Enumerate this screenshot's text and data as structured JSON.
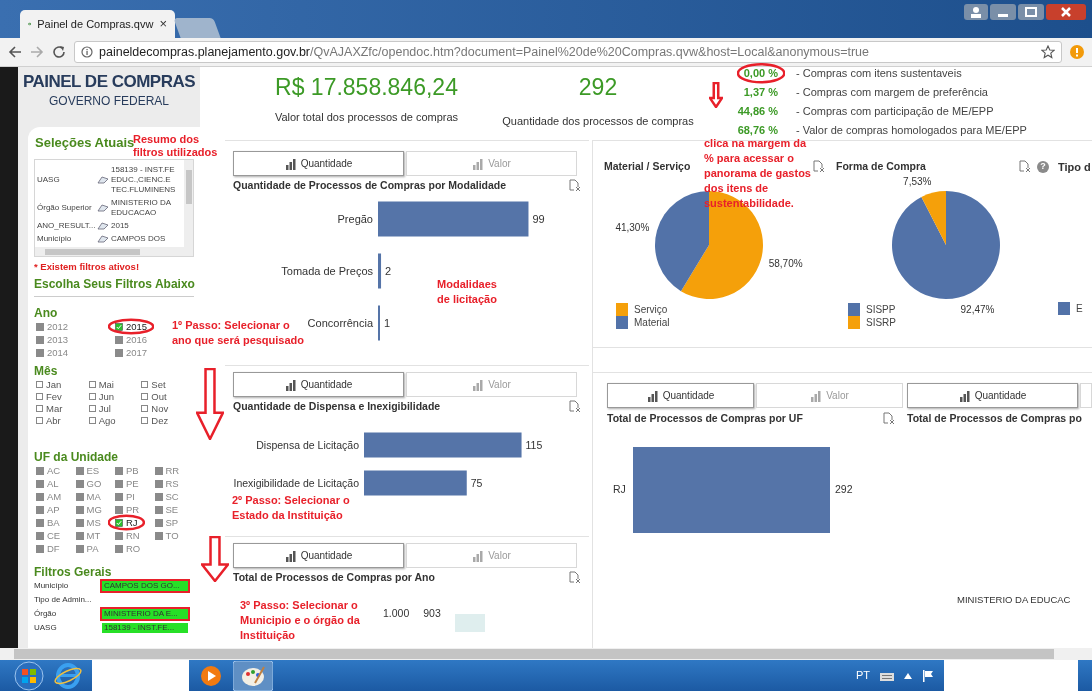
{
  "browser": {
    "tab_title": "Painel de Compras.qvw",
    "tab_close": "×",
    "url_host": "paineldecompras.planejamento.gov.br",
    "url_path": "/QvAJAXZfc/opendoc.htm?document=Painel%20de%20Compras.qvw&host=Local&anonymous=true"
  },
  "logo": {
    "title": "PAINEL DE COMPRAS",
    "subtitle": "GOVERNO FEDERAL"
  },
  "current_selections": {
    "title": "Seleções Atuais",
    "rows": [
      {
        "field": "UASG",
        "value": "158139 - INST.FE EDUC.,CIENC.E TEC.FLUMINENS"
      },
      {
        "field": "Órgão Superior",
        "value": "MINISTERIO DA EDUCACAO"
      },
      {
        "field": "ANO_RESULT...",
        "value": "2015"
      },
      {
        "field": "Município",
        "value": "CAMPOS DOS"
      }
    ],
    "warning": "* Existem filtros ativos!"
  },
  "filters_heading": "Escolha Seus Filtros Abaixo",
  "ano": {
    "title": "Ano",
    "items": [
      {
        "label": "2012",
        "selected": false
      },
      {
        "label": "2013",
        "selected": false
      },
      {
        "label": "2014",
        "selected": false
      },
      {
        "label": "2015",
        "selected": true
      },
      {
        "label": "2016",
        "selected": false
      },
      {
        "label": "2017",
        "selected": false
      }
    ]
  },
  "mes": {
    "title": "Mês",
    "items": [
      {
        "label": "Jan",
        "checked": false
      },
      {
        "label": "Fev",
        "checked": false
      },
      {
        "label": "Mar",
        "checked": false
      },
      {
        "label": "Abr",
        "checked": false
      },
      {
        "label": "Mai",
        "checked": false
      },
      {
        "label": "Jun",
        "checked": false
      },
      {
        "label": "Jul",
        "checked": false
      },
      {
        "label": "Ago",
        "checked": false
      },
      {
        "label": "Set",
        "checked": false
      },
      {
        "label": "Out",
        "checked": false
      },
      {
        "label": "Nov",
        "checked": false
      },
      {
        "label": "Dez",
        "checked": false
      }
    ]
  },
  "uf": {
    "title": "UF da Unidade",
    "items": [
      {
        "label": "AC",
        "selected": false
      },
      {
        "label": "AL",
        "selected": false
      },
      {
        "label": "AM",
        "selected": false
      },
      {
        "label": "AP",
        "selected": false
      },
      {
        "label": "BA",
        "selected": false
      },
      {
        "label": "CE",
        "selected": false
      },
      {
        "label": "DF",
        "selected": false
      },
      {
        "label": "ES",
        "selected": false
      },
      {
        "label": "GO",
        "selected": false
      },
      {
        "label": "MA",
        "selected": false
      },
      {
        "label": "MG",
        "selected": false
      },
      {
        "label": "MS",
        "selected": false
      },
      {
        "label": "MT",
        "selected": false
      },
      {
        "label": "PA",
        "selected": false
      },
      {
        "label": "PB",
        "selected": false
      },
      {
        "label": "PE",
        "selected": false
      },
      {
        "label": "PI",
        "selected": false
      },
      {
        "label": "PR",
        "selected": false
      },
      {
        "label": "RJ",
        "selected": true
      },
      {
        "label": "RN",
        "selected": false
      },
      {
        "label": "RO",
        "selected": false
      },
      {
        "label": "RR",
        "selected": false
      },
      {
        "label": "RS",
        "selected": false
      },
      {
        "label": "SC",
        "selected": false
      },
      {
        "label": "SE",
        "selected": false
      },
      {
        "label": "SP",
        "selected": false
      },
      {
        "label": "TO",
        "selected": false
      }
    ]
  },
  "general_filters": {
    "title": "Filtros Gerais",
    "rows": [
      {
        "label": "Município",
        "value": "CAMPOS DOS GO..."
      },
      {
        "label": "Tipo de Admin..."
      },
      {
        "label": "Órgão",
        "value": "MINISTERIO DA E..."
      },
      {
        "label": "UASG",
        "value": "158139 - INST.FE..."
      }
    ]
  },
  "kpis": [
    {
      "value": "R$ 17.858.846,24",
      "caption": "Valor total dos processos de compras"
    },
    {
      "value": "292",
      "caption": "Quantidade dos processos de compras"
    }
  ],
  "indicators": [
    {
      "value": "0,00 %",
      "label": "- Compras com itens sustentaveis"
    },
    {
      "value": "1,37 %",
      "label": "- Compras com margem de preferência"
    },
    {
      "value": "44,86 %",
      "label": "- Compras com participação de ME/EPP"
    },
    {
      "value": "68,76 %",
      "label": "- Valor de compras homologados para ME/EPP"
    }
  ],
  "modalidade_panel": {
    "toggles": [
      {
        "label": "Quantidade",
        "selected": true
      },
      {
        "label": "Valor",
        "selected": false
      }
    ],
    "chart_data": {
      "type": "bar",
      "orientation": "horizontal",
      "title": "Quantidade de Processos de Compras por Modalidade",
      "categories": [
        "Pregão",
        "Tomada de Preços",
        "Concorrência"
      ],
      "values": [
        99,
        2,
        1
      ],
      "data_labels": true
    }
  },
  "dispensa_panel": {
    "toggles": [
      {
        "label": "Quantidade",
        "selected": true
      },
      {
        "label": "Valor",
        "selected": false
      }
    ],
    "chart_data": {
      "type": "bar",
      "orientation": "horizontal",
      "title": "Quantidade de Dispensa e Inexigibilidade",
      "categories": [
        "Dispensa de Licitação",
        "Inexigibilidade de Licitação"
      ],
      "values": [
        115,
        75
      ],
      "data_labels": true
    }
  },
  "ano_panel": {
    "toggles": [
      {
        "label": "Quantidade",
        "selected": true
      },
      {
        "label": "Valor",
        "selected": false
      }
    ],
    "title": "Total de Processos de Compras por Ano",
    "axis_labels": [
      "1.000",
      "903"
    ]
  },
  "material_panel": {
    "legend": [
      {
        "color": "#f5a00a"
      },
      {
        "color": "#5272a8"
      }
    ],
    "chart_data": {
      "type": "pie",
      "title": "Material / Serviço",
      "categories": [
        "Serviço",
        "Material"
      ],
      "values": [
        58.7,
        41.3
      ],
      "value_labels": [
        "58,70%",
        "41,30%"
      ]
    }
  },
  "forma_panel": {
    "help": "?",
    "legend": [
      {
        "color": "#5272a8"
      },
      {
        "color": "#f5a00a"
      }
    ],
    "chart_data": {
      "type": "pie",
      "title": "Forma de Compra",
      "categories": [
        "SISPP",
        "SISRP"
      ],
      "values": [
        92.47,
        7.53
      ],
      "value_labels": [
        "92,47%",
        "7,53%"
      ]
    }
  },
  "tipo_panel": {
    "title": "Tipo d",
    "legend": [
      {
        "label": "E",
        "color": "#5272a8"
      }
    ]
  },
  "uf_panel": {
    "toggles": [
      {
        "label": "Quantidade",
        "selected": true
      },
      {
        "label": "Valor",
        "selected": false
      }
    ],
    "title": "Total de Processos de Compras por UF",
    "rows": [
      {
        "label": "RJ",
        "value": "292"
      }
    ]
  },
  "orgao_panel": {
    "toggles": [
      {
        "label": "Quantidade",
        "selected": true
      }
    ],
    "title": "Total de Processos de Compras po",
    "row_label": "MINISTERIO DA EDUCAC"
  },
  "annotations": [
    "Resumo dos filtros utilizados",
    "1º Passo: Selecionar o ano que será pesquisado",
    "Modalidaes de licitação",
    "clica na margem da % para acessar o panorama de gastos dos itens de sustentabilidade.",
    "2º Passo: Selecionar o Estado da Instituição",
    "3º Passo: Selecionar o Municipio e o órgão da Instituição"
  ],
  "taskbar": {
    "language": "PT"
  }
}
